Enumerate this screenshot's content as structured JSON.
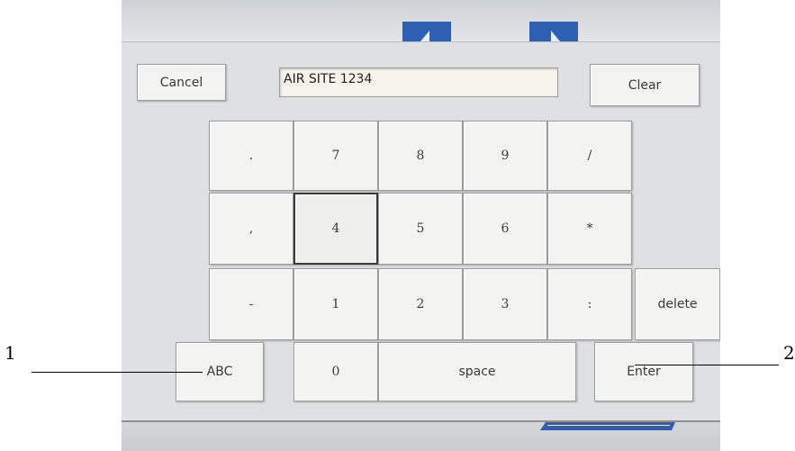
{
  "header": {
    "cancel_label": "Cancel",
    "clear_label": "Clear",
    "input_value": "AIR SITE 1234"
  },
  "keypad": {
    "row1": [
      ".",
      "7",
      "8",
      "9",
      "/"
    ],
    "row2": [
      ",",
      "4",
      "5",
      "6",
      "*"
    ],
    "row3": [
      "-",
      "1",
      "2",
      "3",
      ":",
      "delete"
    ],
    "row4": [
      "ABC",
      "0",
      "space",
      "Enter"
    ]
  },
  "callouts": [
    "1",
    "2"
  ],
  "colors": {
    "nav_arrow": "#2f5fb3",
    "screen_bg": "#dfe0e2"
  }
}
